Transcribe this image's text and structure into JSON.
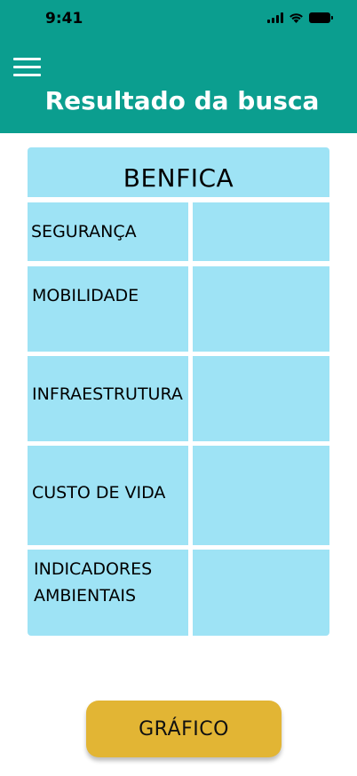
{
  "status_bar": {
    "time": "9:41"
  },
  "header": {
    "title": "Resultado da busca",
    "menu_icon": "hamburger-menu-icon"
  },
  "table": {
    "title": "BENFICA",
    "rows": [
      {
        "label": "SEGURANÇA"
      },
      {
        "label": "MOBILIDADE"
      },
      {
        "label": "INFRAESTRUTURA"
      },
      {
        "label": "CUSTO DE VIDA"
      },
      {
        "label": "INDICADORES AMBIENTAIS",
        "label_line1": "INDICADORES",
        "label_line2": "AMBIENTAIS"
      }
    ]
  },
  "actions": {
    "graph_button_label": "GRÁFICO"
  },
  "colors": {
    "header": "#0b9e8f",
    "cell": "#9ee3f5",
    "button": "#e2b534",
    "title_text": "#ffffff"
  }
}
